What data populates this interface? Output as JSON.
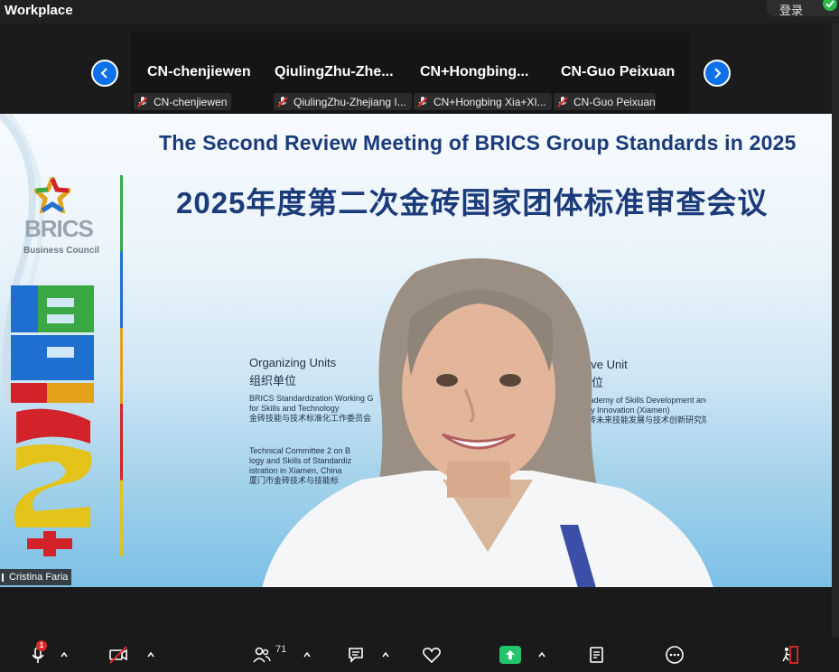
{
  "window": {
    "title": "Workplace",
    "login_label": "登录"
  },
  "gallery": {
    "tiles": [
      {
        "name": "CN-chenjiewen",
        "label": "CN-chenjiewen"
      },
      {
        "name": "QiulingZhu-Zhe...",
        "label": "QiulingZhu-Zhejiang I..."
      },
      {
        "name": "CN+Hongbing...",
        "label": "CN+Hongbing Xia+XI..."
      },
      {
        "name": "CN-Guo Peixuan",
        "label": "CN-Guo Peixuan"
      }
    ]
  },
  "slide": {
    "title_en": "The  Second  Review Meeting of BRICS Group Standards  in 2025",
    "title_cn": "2025年度第二次金砖国家团体标准审查会议",
    "logo_text": "BRICS",
    "logo_sub": "Business Council",
    "organizing_title": "Organizing Units",
    "organizing_cn": "组织单位",
    "organizing_line1": "BRICS Standardization Working G",
    "organizing_line2": "for Skills and Technology",
    "organizing_line3": "金砖技能与技术标准化工作委员会",
    "tc_line1": "Technical Committee 2 on B",
    "tc_line2": "logy and Skills of Standardiz",
    "tc_line3": "istration in Xiamen, China",
    "tc_line4": "厦门市金砖技术与技能标",
    "exec_title": "cutive Unit",
    "exec_cn": "单位",
    "exec_line1": "Academy of Skills Development and",
    "exec_line2": "logy Innovation (Xiamen)",
    "exec_line3": "金砖未来技能发展与技术创新研究院"
  },
  "speaker": {
    "name": "Cristina Faria"
  },
  "toolbar": {
    "participants_count": "71",
    "mute_badge": "1"
  },
  "colors": {
    "accent": "#0e71eb",
    "share": "#23c46b",
    "title_blue": "#1b3b7a"
  }
}
